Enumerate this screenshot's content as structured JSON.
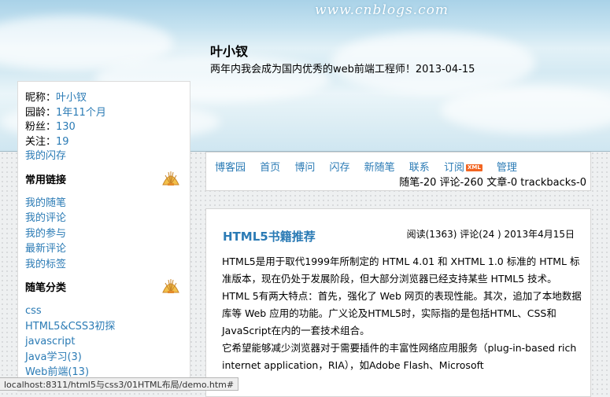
{
  "header": {
    "logo_text": "www.cnblogs.com",
    "title": "叶小钗",
    "subtitle": "两年内我会成为国内优秀的web前端工程师！2013-04-15"
  },
  "profile": {
    "nickname_label": "昵称：",
    "nickname": "叶小钗",
    "age_label": "园龄：",
    "age": "1年11个月",
    "fans_label": "粉丝：",
    "fans": "130",
    "follow_label": "关注：",
    "follow": "19",
    "flash_link": "我的闪存"
  },
  "common_links": {
    "title": "常用链接",
    "items": [
      "我的随笔",
      "我的评论",
      "我的参与",
      "最新评论",
      "我的标签"
    ]
  },
  "categories": {
    "title": "随笔分类",
    "items": [
      "css",
      "HTML5&CSS3初探",
      "javascript",
      "Java学习(3)",
      "Web前端(13)"
    ]
  },
  "nav": {
    "links": [
      "博客园",
      "首页",
      "博问",
      "闪存",
      "新随笔",
      "联系",
      "订阅",
      "管理"
    ],
    "xml_badge": "XML",
    "stats": "随笔-20 评论-260 文章-0 trackbacks-0"
  },
  "post": {
    "title": "HTML5书籍推荐",
    "meta": "阅读(1363) 评论(24 ) 2013年4月15日",
    "paragraphs": [
      "HTML5是用于取代1999年所制定的 HTML 4.01 和 XHTML 1.0 标准的 HTML 标准版本，现在仍处于发展阶段，但大部分浏览器已经支持某些 HTML5 技术。",
      "HTML 5有两大特点：首先，强化了 Web 网页的表现性能。其次，追加了本地数据库等 Web 应用的功能。广义论及HTML5时，实际指的是包括HTML、CSS和JavaScript在内的一套技术组合。",
      "它希望能够减少浏览器对于需要插件的丰富性网络应用服务（plug-in-based rich internet application，RIA），如Adobe Flash、Microsoft"
    ]
  },
  "statusbar": {
    "url": "localhost:8311/html5与css3/01HTML布局/demo.htm#"
  },
  "colors": {
    "link": "#2b7bb5",
    "header_sky": "#c5e2f0",
    "xml_badge": "#f26522"
  }
}
